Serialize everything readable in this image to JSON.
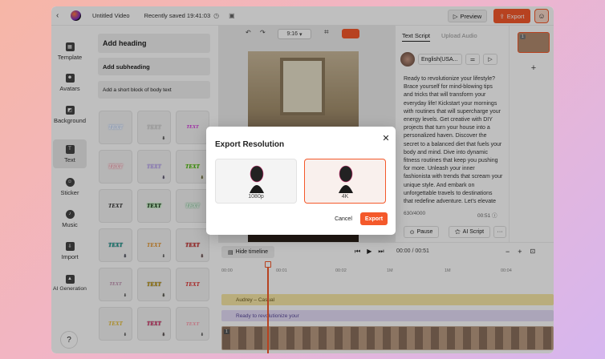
{
  "topbar": {
    "title": "Untitled Video",
    "saved": "Recently saved 19:41:03",
    "preview_label": "Preview",
    "export_label": "Export"
  },
  "nav": [
    {
      "label": "Template",
      "icon": "template-icon"
    },
    {
      "label": "Avatars",
      "icon": "avatars-icon"
    },
    {
      "label": "Background",
      "icon": "background-icon"
    },
    {
      "label": "Text",
      "icon": "text-icon"
    },
    {
      "label": "Sticker",
      "icon": "sticker-icon"
    },
    {
      "label": "Music",
      "icon": "music-icon"
    },
    {
      "label": "Import",
      "icon": "import-icon"
    },
    {
      "label": "AI Generation",
      "icon": "ai-generation-icon"
    }
  ],
  "text_panel": {
    "heading": "Add heading",
    "subheading": "Add subheading",
    "body": "Add a short block of body text",
    "tile_label": "TEXT"
  },
  "canvas": {
    "ratio": "9:16"
  },
  "script_panel": {
    "tab_script": "Text Script",
    "tab_audio": "Upload Audio",
    "voice": "English(USA...",
    "text": "Ready to revolutionize your lifestyle? Brace yourself for mind-blowing tips and tricks that will transform your everyday life! Kickstart your mornings with routines that will supercharge your energy levels. Get creative with DIY projects that turn your house into a personalized haven. Discover the secret to a balanced diet that fuels your body and mind. Dive into dynamic fitness routines that keep you pushing for more. Unleash your inner fashionista with trends that scream your unique style. And embark on unforgettable travels to destinations that redefine adventure. Let's elevate",
    "counter": "630/4000",
    "duration": "00:51",
    "pause_label": "Pause",
    "ai_label": "AI Script",
    "more_label": "···"
  },
  "scenes": {
    "first_num": "1",
    "add": "+"
  },
  "timeline": {
    "hide_label": "Hide timeline",
    "timecode": "00:00 / 00:51",
    "ruler": [
      "00:00",
      "00:01",
      "00:02",
      "1M",
      "1M",
      "00:04"
    ],
    "audio_track": "Audrey – Casual",
    "script_track": "Ready to revolutionize your",
    "video_num": "1"
  },
  "modal": {
    "title": "Export Resolution",
    "options": [
      {
        "label": "1080p",
        "selected": false
      },
      {
        "label": "4K",
        "selected": true
      }
    ],
    "cancel_label": "Cancel",
    "export_label": "Export"
  },
  "colors": {
    "accent": "#f4592b",
    "background": "#f3b3b8"
  }
}
